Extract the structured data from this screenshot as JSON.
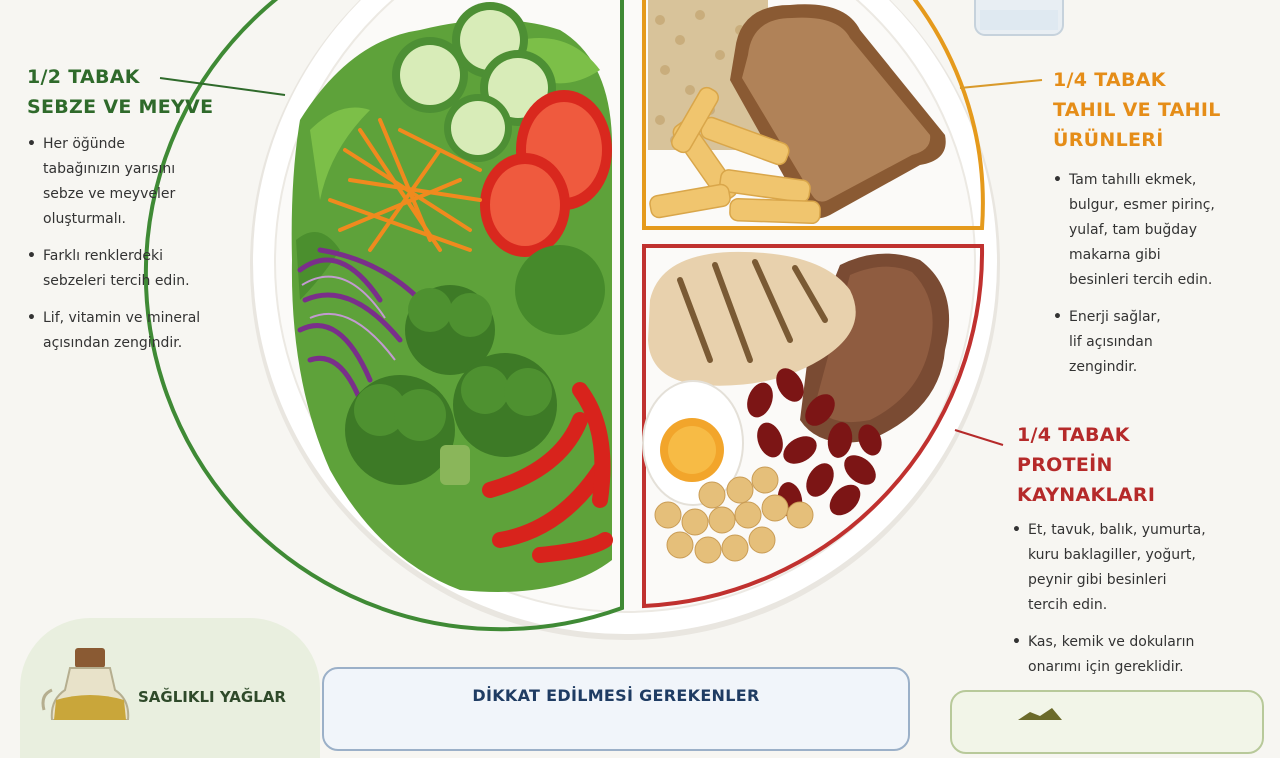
{
  "colors": {
    "vegetables": "#2f6a2b",
    "grains": "#e58d18",
    "protein": "#b52a2a",
    "dikkat_border": "#9bb0c8"
  },
  "plate_sections": [
    {
      "id": "vegetables",
      "heading_lines": [
        "1/2 TABAK",
        "SEBZE VE MEYVE"
      ],
      "bullets": [
        "Her öğünde\ntabağınızın yarısını\nsebze ve meyveler\noluşturmalı.",
        "Farklı renklerdeki\nsebzeleri tercih edin.",
        "Lif, vitamin ve mineral\naçısından zengindir."
      ]
    },
    {
      "id": "grains",
      "heading_lines": [
        "1/4 TABAK",
        "TAHIL VE TAHIL",
        "ÜRÜNLERİ"
      ],
      "bullets": [
        "Tam tahıllı ekmek,\nbulgur, esmer pirinç,\nyulaf, tam buğday\nmakarna gibi\nbesinleri tercih edin.",
        "Enerji sağlar,\nlif açısından\nzengindir."
      ]
    },
    {
      "id": "protein",
      "heading_lines": [
        "1/4 TABAK",
        "PROTEİN",
        "KAYNAKLARI"
      ],
      "bullets": [
        "Et, tavuk, balık, yumurta,\nkuru baklagiller, yoğurt,\npeynir gibi besinleri\ntercih edin.",
        "Kas, kemik ve dokuların\nonarımı için gereklidir."
      ]
    }
  ],
  "healthy_fats": {
    "label": "SAĞLIKLI YAĞLAR",
    "icon": "oil-bottle-icon"
  },
  "attention": {
    "title": "DİKKAT EDİLMESİ GEREKENLER"
  },
  "icons": [
    "water-glass-icon",
    "plate-icon",
    "oil-bottle-icon",
    "bread-icon",
    "egg-icon",
    "broccoli-icon"
  ]
}
